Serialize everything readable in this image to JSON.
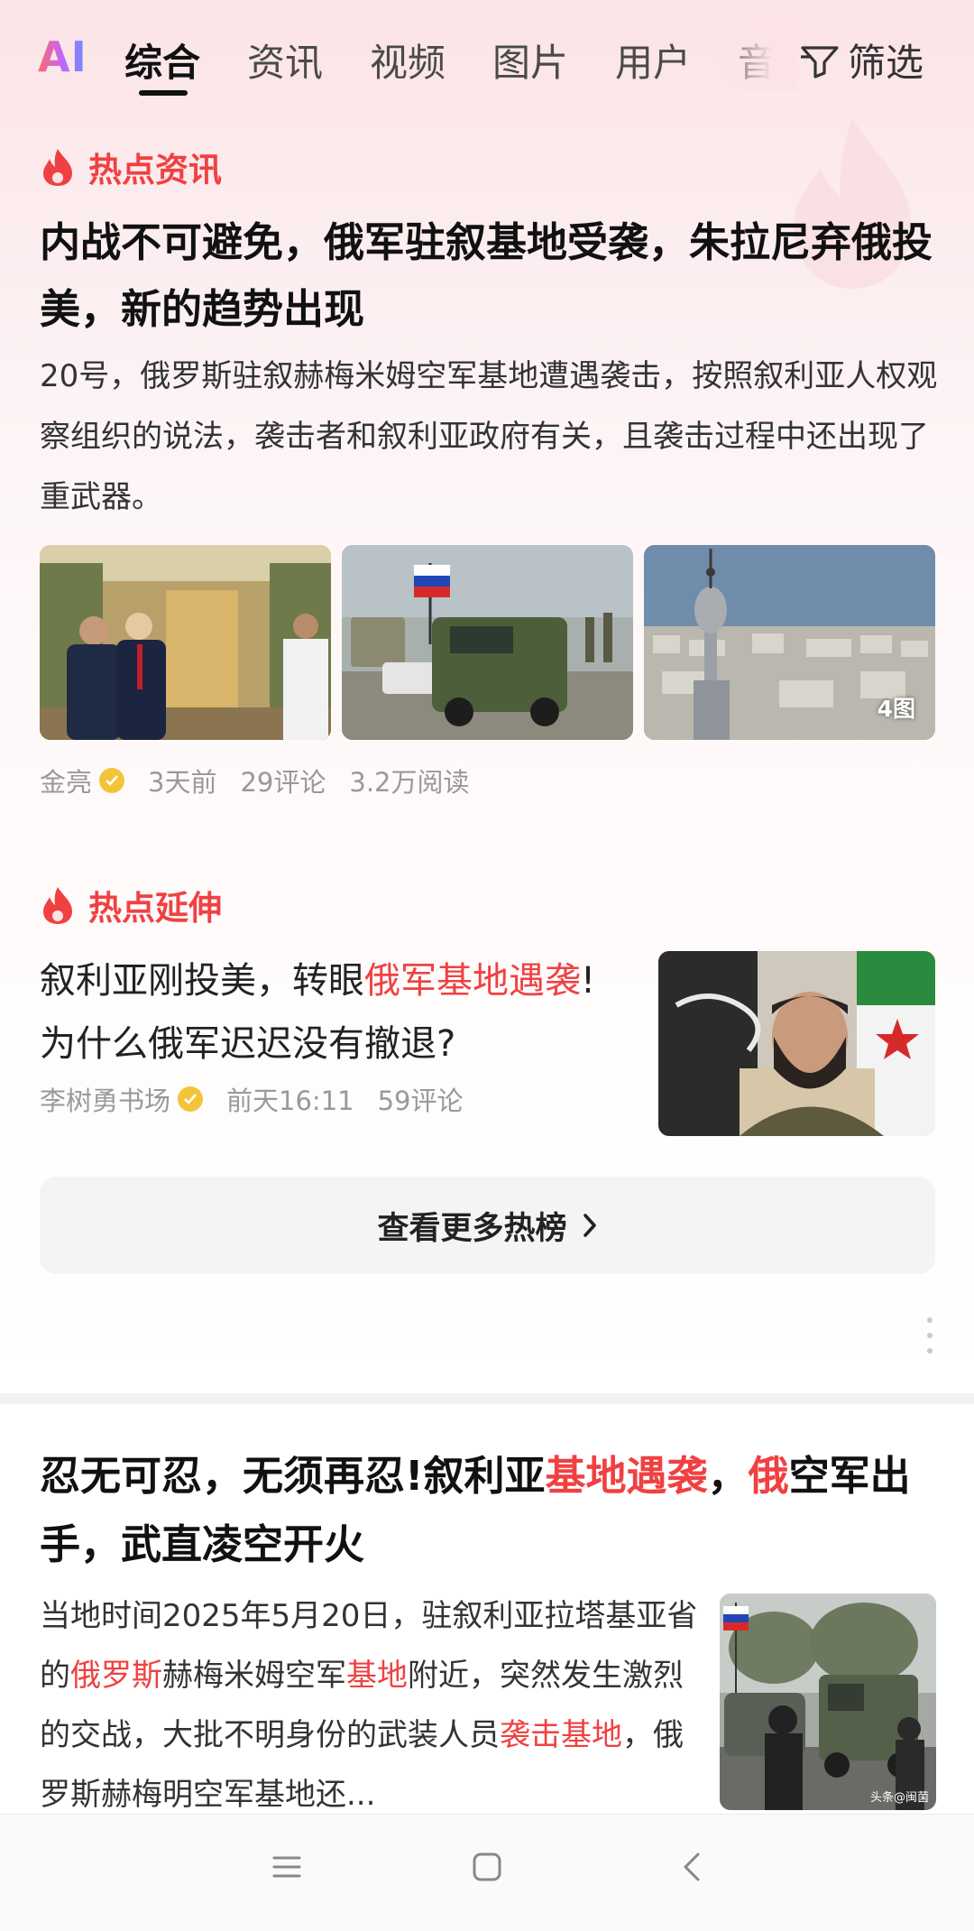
{
  "tabs": {
    "ai_logo": "AI",
    "items": [
      "综合",
      "资讯",
      "视频",
      "图片",
      "用户",
      "音"
    ],
    "active_index": 0,
    "filter_label": "筛选"
  },
  "section1": {
    "header": "热点资讯",
    "title": "内战不可避免，俄军驻叙基地受袭，朱拉尼弃俄投美，新的趋势出现",
    "desc": "20号，俄罗斯驻叙赫梅米姆空军基地遭遇袭击，按照叙利亚人权观察组织的说法，袭击者和叙利亚政府有关，且袭击过程中还出现了重武器。",
    "image_count": "4图",
    "meta": {
      "author": "金亮",
      "time": "3天前",
      "comments": "29评论",
      "reads": "3.2万阅读"
    }
  },
  "section2": {
    "header": "热点延伸",
    "title_parts": [
      "叙利亚刚投美，转眼",
      "俄军基地遇袭",
      "!为什么俄军迟迟没有撤退?"
    ],
    "meta": {
      "author": "李树勇书场",
      "time": "前天16:11",
      "comments": "59评论"
    },
    "more_button": "查看更多热榜"
  },
  "article3": {
    "title_parts": [
      "忍无可忍，无须再忍!叙利亚",
      "基地遇袭",
      "，",
      "俄",
      "空军出手，武直凌空开火"
    ],
    "desc_parts": [
      "当地时间2025年5月20日，驻叙利亚拉塔基亚省的",
      "俄罗斯",
      "赫梅米姆空军",
      "基地",
      "附近，突然发生激烈的交战，大批不明身份的武装人员",
      "袭击基地",
      "，俄罗斯赫梅明空军基地还..."
    ],
    "thumb_watermark": "头条@闽菌"
  },
  "colors": {
    "accent_red": "#f04142",
    "verified": "#f3c43a"
  },
  "icons": [
    "flame-icon",
    "filter-icon",
    "verified-badge-icon",
    "chevron-right-icon",
    "more-vertical-icon",
    "menu-icon",
    "home-square-icon",
    "back-icon"
  ]
}
